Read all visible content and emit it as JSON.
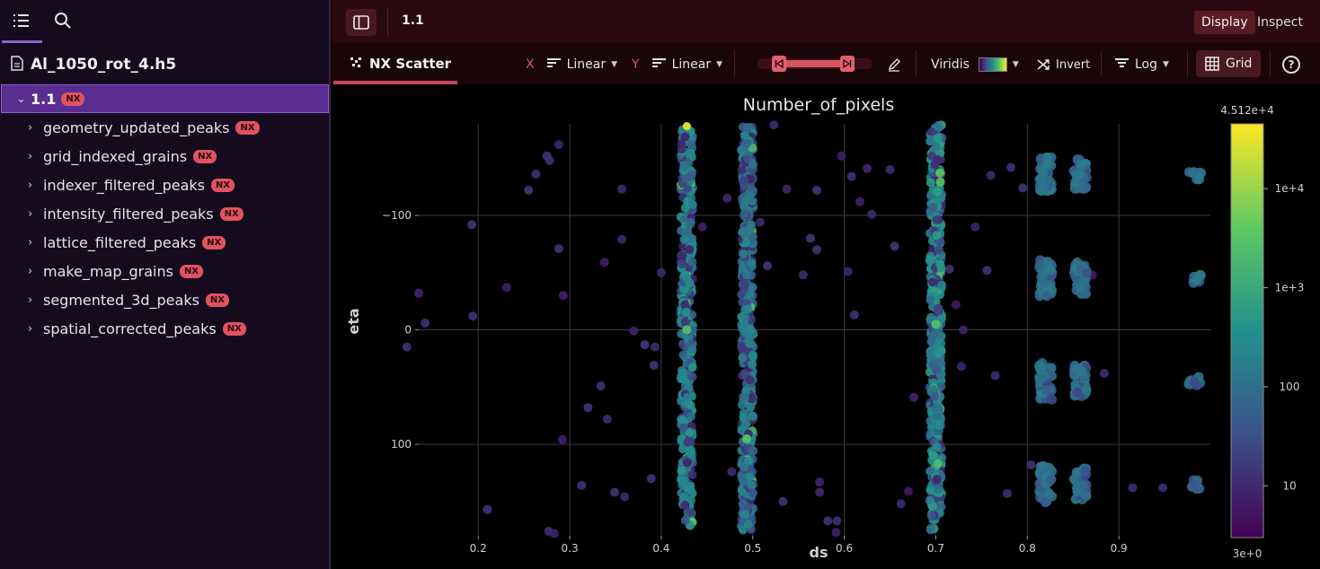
{
  "sidebar": {
    "file_name": "Al_1050_rot_4.h5",
    "root": {
      "label": "1.1",
      "badge": "NX"
    },
    "items": [
      {
        "label": "geometry_updated_peaks",
        "badge": "NX"
      },
      {
        "label": "grid_indexed_grains",
        "badge": "NX"
      },
      {
        "label": "indexer_filtered_peaks",
        "badge": "NX"
      },
      {
        "label": "intensity_filtered_peaks",
        "badge": "NX"
      },
      {
        "label": "lattice_filtered_peaks",
        "badge": "NX"
      },
      {
        "label": "make_map_grains",
        "badge": "NX"
      },
      {
        "label": "segmented_3d_peaks",
        "badge": "NX"
      },
      {
        "label": "spatial_corrected_peaks",
        "badge": "NX"
      }
    ]
  },
  "topbar": {
    "breadcrumb": "1.1",
    "display_label": "Display",
    "inspect_label": "Inspect"
  },
  "toolbar": {
    "tab_label": "NX Scatter",
    "x_axis_letter": "X",
    "x_scale": "Linear",
    "y_axis_letter": "Y",
    "y_scale": "Linear",
    "colormap": "Viridis",
    "invert_label": "Invert",
    "color_scale": "Log",
    "grid_label": "Grid",
    "help_glyph": "?"
  },
  "colors": {
    "accent": "#e0535f",
    "selection": "#5a2d90",
    "topbar": "#2a0a10"
  },
  "chart_data": {
    "type": "scatter",
    "title": "Number_of_pixels",
    "xlabel": "ds",
    "ylabel": "eta",
    "xlim": [
      0.135,
      1.0
    ],
    "ylim": [
      180,
      -180
    ],
    "y_reversed": true,
    "xticks": [
      0.2,
      0.3,
      0.4,
      0.5,
      0.6,
      0.7,
      0.8,
      0.9
    ],
    "xtick_labels": [
      "0.2",
      "0.3",
      "0.4",
      "0.5",
      "0.6",
      "0.7",
      "0.8",
      "0.9"
    ],
    "yticks": [
      -100,
      0,
      100
    ],
    "ytick_labels": [
      "−100",
      "0",
      "100"
    ],
    "grid": true,
    "colorbar": {
      "colormap": "viridis",
      "scale": "log",
      "min": 3,
      "max": 45120,
      "min_label": "3e+0",
      "max_label": "4.512e+4",
      "ticks": [
        10,
        100,
        1000,
        10000
      ],
      "tick_labels": [
        "10",
        "100",
        "1e+3",
        "1e+4"
      ]
    },
    "rings": [
      {
        "ds": 0.428,
        "eta_range": [
          -178,
          172
        ],
        "value": 500
      },
      {
        "ds": 0.494,
        "eta_range": [
          -178,
          175
        ],
        "value": 300
      },
      {
        "ds": 0.7,
        "eta_range": [
          -180,
          175
        ],
        "value": 600
      }
    ],
    "clusters": [
      {
        "ds": 0.82,
        "eta": -135,
        "spread": 16,
        "value": 150
      },
      {
        "ds": 0.82,
        "eta": -45,
        "spread": 16,
        "value": 150
      },
      {
        "ds": 0.82,
        "eta": 45,
        "spread": 16,
        "value": 150
      },
      {
        "ds": 0.82,
        "eta": 135,
        "spread": 16,
        "value": 150
      },
      {
        "ds": 0.858,
        "eta": -135,
        "spread": 14,
        "value": 150
      },
      {
        "ds": 0.858,
        "eta": -45,
        "spread": 14,
        "value": 150
      },
      {
        "ds": 0.858,
        "eta": 45,
        "spread": 14,
        "value": 150
      },
      {
        "ds": 0.858,
        "eta": 135,
        "spread": 14,
        "value": 150
      },
      {
        "ds": 0.983,
        "eta": -135,
        "spread": 4,
        "value": 150
      },
      {
        "ds": 0.983,
        "eta": -45,
        "spread": 4,
        "value": 150
      },
      {
        "ds": 0.983,
        "eta": 45,
        "spread": 4,
        "value": 150
      },
      {
        "ds": 0.983,
        "eta": 135,
        "spread": 4,
        "value": 150
      }
    ],
    "scattered_points": [
      [
        0.122,
        15
      ],
      [
        0.135,
        -32
      ],
      [
        0.142,
        -6
      ],
      [
        0.193,
        -92
      ],
      [
        0.194,
        -12
      ],
      [
        0.21,
        157
      ],
      [
        0.231,
        -37
      ],
      [
        0.255,
        -122
      ],
      [
        0.263,
        -136
      ],
      [
        0.275,
        -152
      ],
      [
        0.278,
        -148
      ],
      [
        0.288,
        -162
      ],
      [
        0.288,
        -71
      ],
      [
        0.293,
        -30
      ],
      [
        0.277,
        176
      ],
      [
        0.283,
        178
      ],
      [
        0.292,
        96
      ],
      [
        0.313,
        136
      ],
      [
        0.32,
        68
      ],
      [
        0.334,
        49
      ],
      [
        0.338,
        -59
      ],
      [
        0.341,
        78
      ],
      [
        0.349,
        142
      ],
      [
        0.357,
        -123
      ],
      [
        0.357,
        -79
      ],
      [
        0.36,
        146
      ],
      [
        0.382,
        13
      ],
      [
        0.392,
        31
      ],
      [
        0.4,
        -50
      ],
      [
        0.393,
        15
      ],
      [
        0.389,
        130
      ],
      [
        0.37,
        1
      ],
      [
        0.445,
        -90
      ],
      [
        0.472,
        -115
      ],
      [
        0.477,
        124
      ],
      [
        0.508,
        -94
      ],
      [
        0.516,
        -56
      ],
      [
        0.523,
        -179
      ],
      [
        0.533,
        150
      ],
      [
        0.537,
        -123
      ],
      [
        0.555,
        -48
      ],
      [
        0.57,
        -122
      ],
      [
        0.57,
        -70
      ],
      [
        0.573,
        133
      ],
      [
        0.573,
        142
      ],
      [
        0.563,
        -80
      ],
      [
        0.582,
        167
      ],
      [
        0.591,
        177
      ],
      [
        0.592,
        167
      ],
      [
        0.597,
        -152
      ],
      [
        0.608,
        -134
      ],
      [
        0.604,
        -51
      ],
      [
        0.611,
        -13
      ],
      [
        0.617,
        -112
      ],
      [
        0.625,
        -141
      ],
      [
        0.63,
        -101
      ],
      [
        0.65,
        -140
      ],
      [
        0.655,
        -73
      ],
      [
        0.662,
        152
      ],
      [
        0.67,
        141
      ],
      [
        0.676,
        59
      ],
      [
        0.697,
        -72
      ],
      [
        0.715,
        -53
      ],
      [
        0.722,
        -22
      ],
      [
        0.728,
        32
      ],
      [
        0.73,
        0
      ],
      [
        0.76,
        -135
      ],
      [
        0.743,
        -90
      ],
      [
        0.756,
        -52
      ],
      [
        0.765,
        40
      ],
      [
        0.778,
        143
      ],
      [
        0.795,
        -124
      ],
      [
        0.782,
        -142
      ],
      [
        0.804,
        118
      ],
      [
        0.871,
        -48
      ],
      [
        0.884,
        38
      ],
      [
        0.915,
        138
      ],
      [
        0.948,
        138
      ],
      [
        0.98,
        43
      ]
    ]
  }
}
